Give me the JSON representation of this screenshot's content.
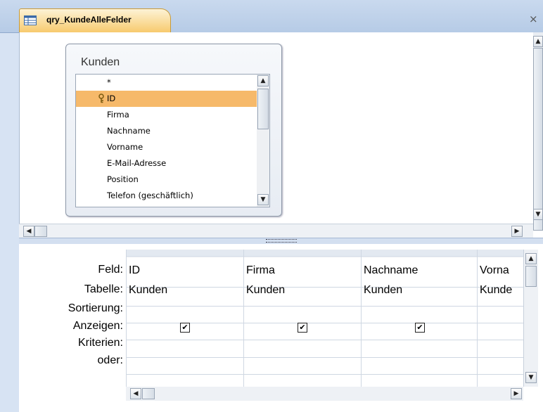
{
  "window": {
    "tab_title": "qry_KundeAlleFelder",
    "close_glyph": "×",
    "tab_icon": "query-icon"
  },
  "table_box": {
    "title": "Kunden",
    "selected_field": "ID",
    "fields": [
      {
        "label": "*",
        "key_icon": false
      },
      {
        "label": "ID",
        "key_icon": true
      },
      {
        "label": "Firma",
        "key_icon": false
      },
      {
        "label": "Nachname",
        "key_icon": false
      },
      {
        "label": "Vorname",
        "key_icon": false
      },
      {
        "label": "E-Mail-Adresse",
        "key_icon": false
      },
      {
        "label": "Position",
        "key_icon": false
      },
      {
        "label": "Telefon (geschäftlich)",
        "key_icon": false
      }
    ]
  },
  "design_grid": {
    "row_labels": {
      "field": "Feld:",
      "table": "Tabelle:",
      "sort": "Sortierung:",
      "show": "Anzeigen:",
      "criteria": "Kriterien:",
      "or": "oder:"
    },
    "columns": [
      {
        "field": "ID",
        "table": "Kunden",
        "sort": "",
        "show": true,
        "criteria": "",
        "or": ""
      },
      {
        "field": "Firma",
        "table": "Kunden",
        "sort": "",
        "show": true,
        "criteria": "",
        "or": ""
      },
      {
        "field": "Nachname",
        "table": "Kunden",
        "sort": "",
        "show": true,
        "criteria": "",
        "or": ""
      },
      {
        "field": "Vorna",
        "table": "Kunde",
        "sort": "",
        "show": false,
        "criteria": "",
        "or": ""
      }
    ]
  },
  "colors": {
    "tab_active": "#f7c96b",
    "selected_field": "#f6b96a",
    "frame_blue": "#c9d9ee"
  }
}
